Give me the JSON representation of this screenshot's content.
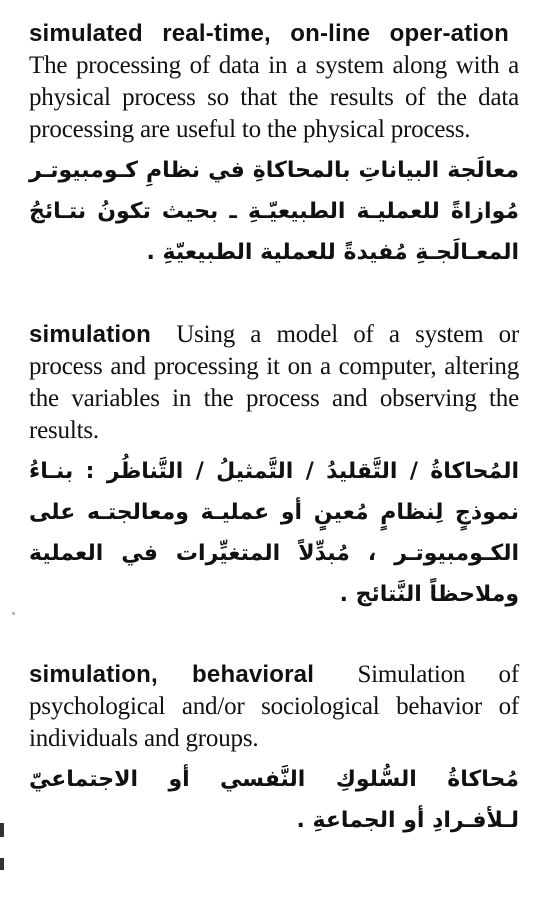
{
  "entries": [
    {
      "term": "simulated real-time, on-line operation",
      "term_display": "simulated real-time, on-line oper-ation",
      "definition_en": "The processing of data in a system along with a physical process so that the results of the data processing are useful to the physical process.",
      "definition_ar": "معالَجة البياناتِ بالمحاكاةِ في نظامِ كـومبيوتـر مُوازاةً للعمليـة الطبيعيّـةِ ـ بحيث تكونُ نتـائجُ المعـالَجـةِ مُفيدةً للعملية الطبيعيّةِ ."
    },
    {
      "term": "simulation",
      "term_display": "simulation",
      "definition_en": "Using a model of a system or process and processing it on a computer, altering the variables in the process and observing the results.",
      "definition_ar": "المُحاكاةُ / التَّقليدُ / التَّمثيلُ / التَّناظُر : بنـاءُ نموذجٍ لِنظامٍ مُعينٍ أو عمليـة ومعالجتـه على الكـومبيوتـر ، مُبدِّلاً المتغيِّرات في العملية وملاحظاً النَّتائج ."
    },
    {
      "term": "simulation, behavioral",
      "term_display": "simulation, behavioral",
      "definition_en": "Simulation of psychological and/or sociological behavior of individuals and groups.",
      "definition_ar": "مُحاكاةُ السُّلوكِ النَّفسي أو الاجتماعيّ لـلأفـرادِ أو الجماعةِ ."
    }
  ]
}
